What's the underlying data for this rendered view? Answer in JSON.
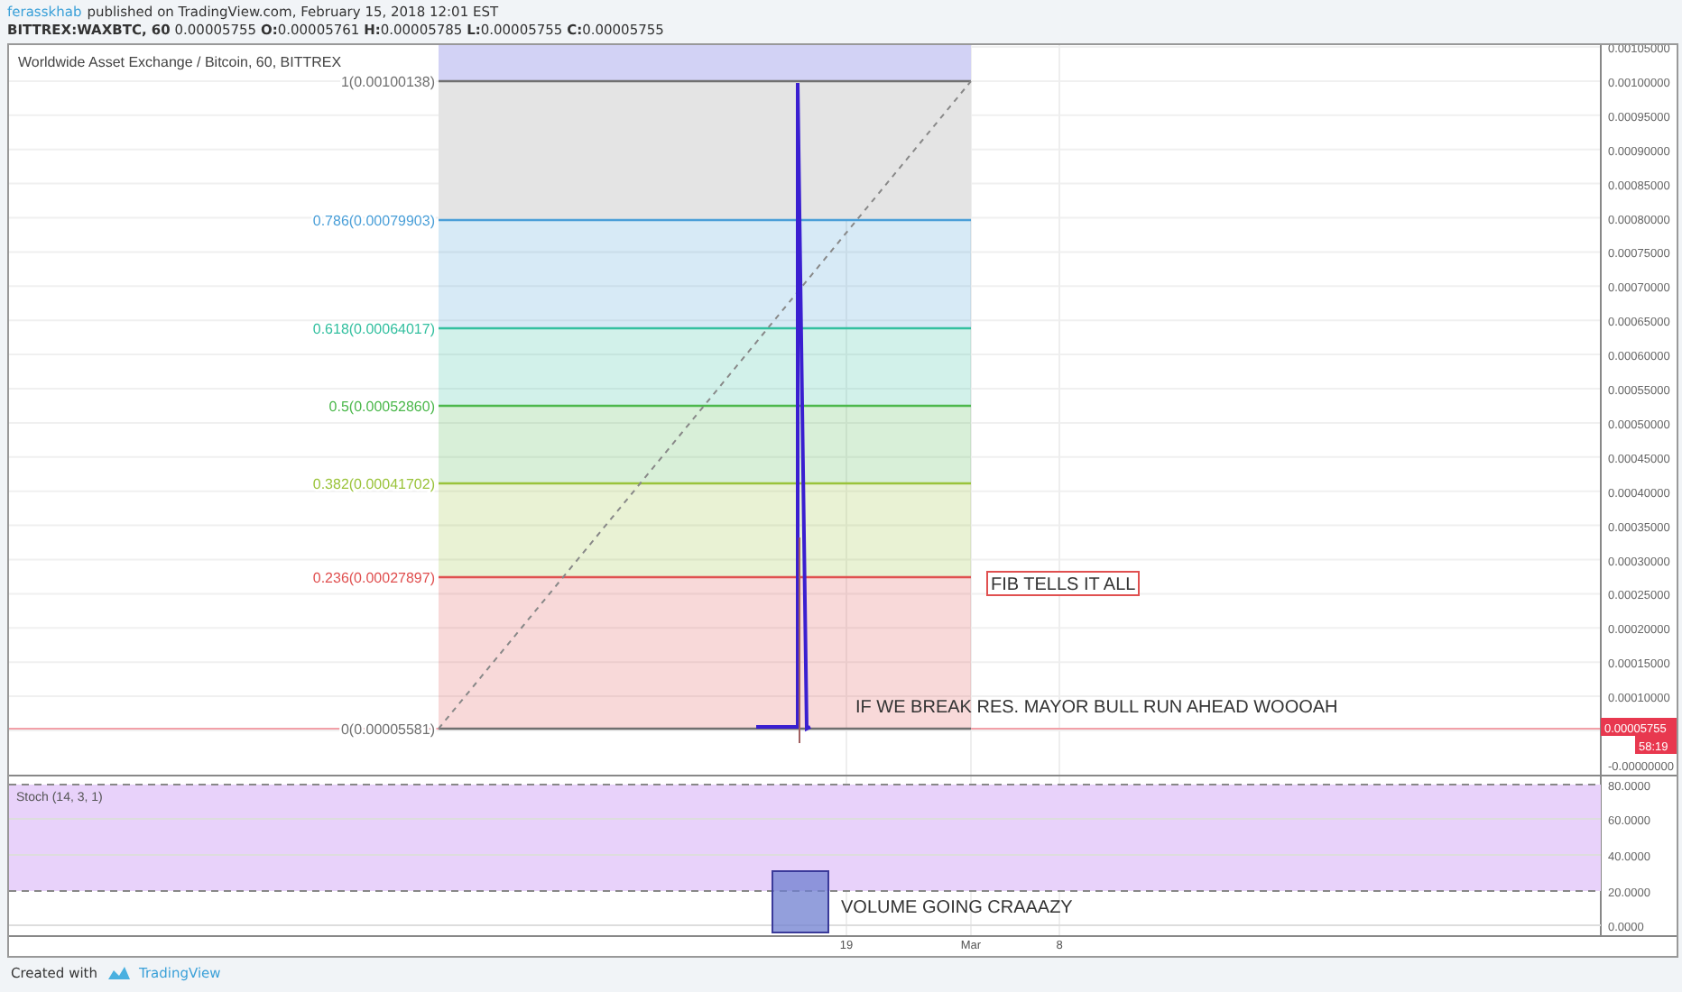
{
  "header": {
    "author": "ferasskhab",
    "published": "published on TradingView.com, February 15, 2018 12:01 EST",
    "quote": "**BITTREX:WAXBTC, 60** 0.00005755 **O:**0.00005761 **H:**0.00005785 **L:**0.00005755 **C:**0.00005755"
  },
  "chart": {
    "title": "Worldwide Asset Exchange / Bitcoin, 60, BITTREX",
    "fib_levels": [
      {
        "label": "1(0.00100138)",
        "color": "#707070"
      },
      {
        "label": "0.786(0.00079903)",
        "color": "#4a9fd8"
      },
      {
        "label": "0.618(0.00064017)",
        "color": "#34c0a0"
      },
      {
        "label": "0.5(0.00052860)",
        "color": "#4cb84c"
      },
      {
        "label": "0.382(0.00041702)",
        "color": "#9ac33a"
      },
      {
        "label": "0.236(0.00027897)",
        "color": "#e05050"
      },
      {
        "label": "0(0.00005581)",
        "color": "#707070"
      }
    ],
    "annotations": [
      {
        "kind": "boxed",
        "text": "FIB TELLS IT ALL"
      },
      {
        "kind": "plain",
        "text": "IF WE BREAK RES. MAYOR BULL RUN AHEAD WOOOAH"
      }
    ],
    "price_axis": [
      "0.00105000",
      "0.00100000",
      "0.00095000",
      "0.00090000",
      "0.00085000",
      "0.00080000",
      "0.00075000",
      "0.00070000",
      "0.00065000",
      "0.00060000",
      "0.00055000",
      "0.00050000",
      "0.00045000",
      "0.00040000",
      "0.00035000",
      "0.00030000",
      "0.00025000",
      "0.00020000",
      "0.00015000",
      "0.00010000",
      "-0.00000000"
    ],
    "last_price": "0.00005755",
    "countdown": "58:19"
  },
  "indicator": {
    "title": "Stoch (14, 3, 1)",
    "axis": [
      "80.0000",
      "60.0000",
      "40.0000",
      "20.0000",
      "0.0000"
    ],
    "annotation": "VOLUME GOING CRAAAZY"
  },
  "time_axis": [
    "19",
    "Mar",
    "8"
  ],
  "footer": {
    "text": "Created with",
    "brand": "TradingView"
  }
}
